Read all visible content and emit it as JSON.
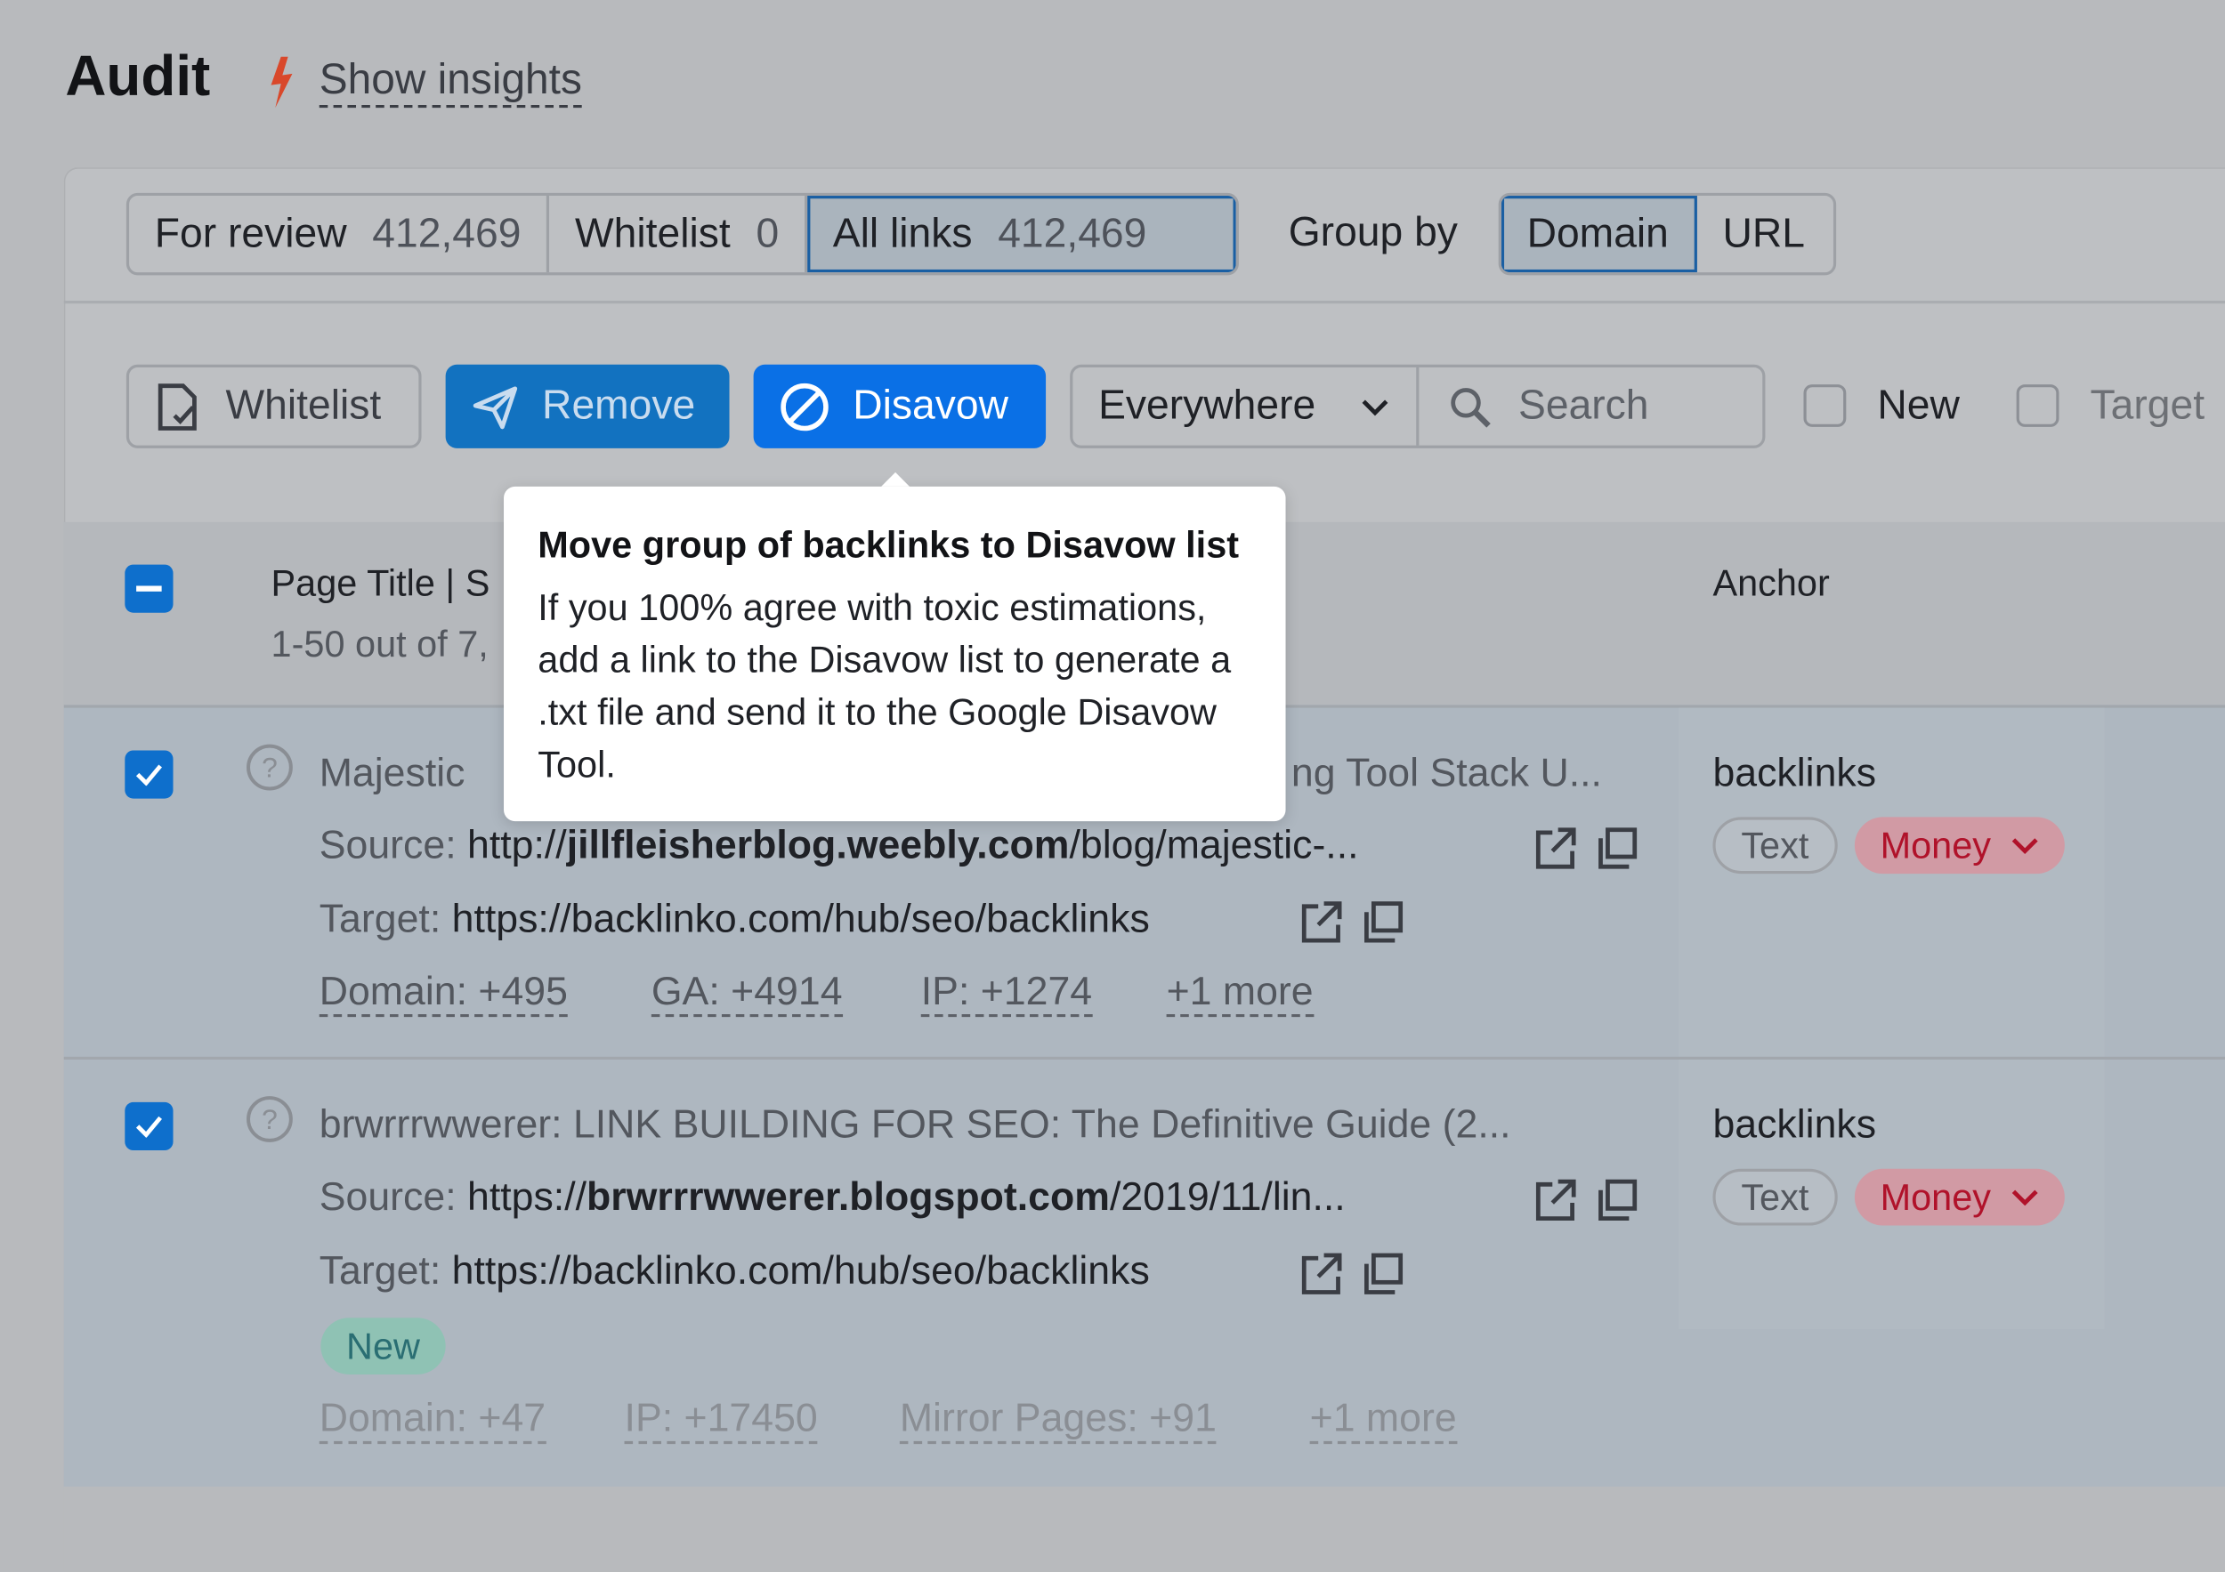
{
  "header": {
    "title": "Audit",
    "insights_link": "Show insights"
  },
  "tabs": [
    {
      "label": "For review",
      "count": "412,469"
    },
    {
      "label": "Whitelist",
      "count": "0"
    },
    {
      "label": "All links",
      "count": "412,469",
      "selected": true
    }
  ],
  "group_by": {
    "label": "Group by",
    "options": [
      "Domain",
      "URL"
    ],
    "selected": "Domain"
  },
  "toolbar": {
    "whitelist": "Whitelist",
    "remove": "Remove",
    "disavow": "Disavow",
    "scope": "Everywhere",
    "search_placeholder": "Search",
    "filters": [
      "New",
      "Target"
    ]
  },
  "table": {
    "col_title": "Page Title | Source URL",
    "col_title_visible": "Page Title | S",
    "range": "1-50 out of 7,",
    "col_anchor": "Anchor"
  },
  "tooltip": {
    "title": "Move group of backlinks to Disavow list",
    "body": "If you 100% agree with toxic estimations, add a link to the Disavow list to generate a .txt file and send it to the Google Disavow Tool."
  },
  "rows": [
    {
      "title_start": "Majestic",
      "title_end": "ng Tool Stack U...",
      "source_label": "Source:",
      "source_pre": "http://",
      "source_domain": "jillfleisherblog.weebly.com",
      "source_path": "/blog/majestic-...",
      "target_label": "Target:",
      "target": "https://backlinko.com/hub/seo/backlinks",
      "anchor": "backlinks",
      "type": "Text",
      "tag": "Money",
      "badge": "",
      "stats": [
        "Domain: +495",
        "GA: +4914",
        "IP: +1274",
        "+1 more"
      ]
    },
    {
      "title_start": "brwrrrwwerer: LINK BUILDING FOR SEO: The Definitive Guide (2...",
      "title_end": "",
      "source_label": "Source:",
      "source_pre": "https://",
      "source_domain": "brwrrrwwerer.blogspot.com",
      "source_path": "/2019/11/lin...",
      "target_label": "Target:",
      "target": "https://backlinko.com/hub/seo/backlinks",
      "anchor": "backlinks",
      "type": "Text",
      "tag": "Money",
      "badge": "New",
      "stats": [
        "Domain: +47",
        "IP: +17450",
        "Mirror Pages: +91",
        "+1 more"
      ]
    }
  ],
  "colors": {
    "primary": "#0a70e6",
    "money": "#b0122a",
    "bolt": "#d9482b",
    "new_badge": "#8fc2b4"
  }
}
